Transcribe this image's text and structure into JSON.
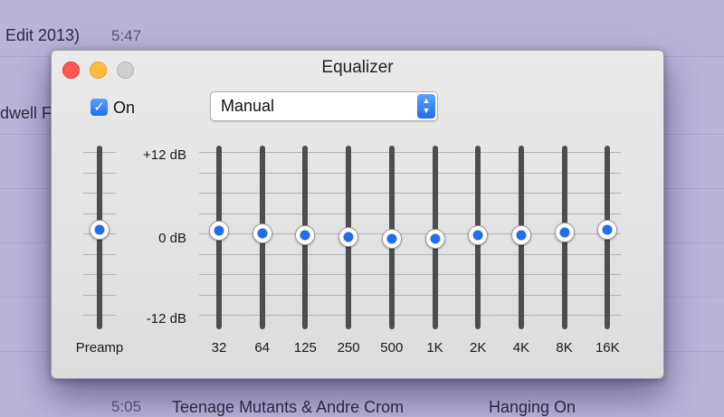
{
  "background": {
    "rows": [
      {
        "text": "Edit 2013)",
        "time": "5:47"
      },
      {
        "text": "dwell F",
        "time": ""
      },
      {
        "text": "",
        "time": "5:05"
      }
    ],
    "bottom_partial": [
      "Teenage Mutants & Andre Crom",
      "Hanging On"
    ]
  },
  "window": {
    "title": "Equalizer",
    "controls": [
      "close-icon",
      "minimize-icon",
      "zoom-icon"
    ]
  },
  "on_toggle": {
    "label": "On",
    "checked": true
  },
  "preset": {
    "value": "Manual"
  },
  "db_labels": {
    "top": "+12 dB",
    "mid": "0 dB",
    "bottom": "-12 dB"
  },
  "preamp": {
    "label": "Preamp",
    "value_db": 1.0
  },
  "bands": [
    {
      "label": "32",
      "value_db": 0.9
    },
    {
      "label": "64",
      "value_db": 0.5
    },
    {
      "label": "125",
      "value_db": 0.3
    },
    {
      "label": "250",
      "value_db": 0.0
    },
    {
      "label": "500",
      "value_db": -0.2
    },
    {
      "label": "1K",
      "value_db": -0.3
    },
    {
      "label": "2K",
      "value_db": 0.2
    },
    {
      "label": "4K",
      "value_db": 0.3
    },
    {
      "label": "8K",
      "value_db": 0.6
    },
    {
      "label": "16K",
      "value_db": 1.1
    }
  ],
  "range_db": [
    -12,
    12
  ],
  "colors": {
    "accent": "#1f6fe8",
    "close": "#fc5753",
    "minimize": "#fdbc40",
    "zoom": "#cfcfcf",
    "track": "#4d4d4d"
  }
}
